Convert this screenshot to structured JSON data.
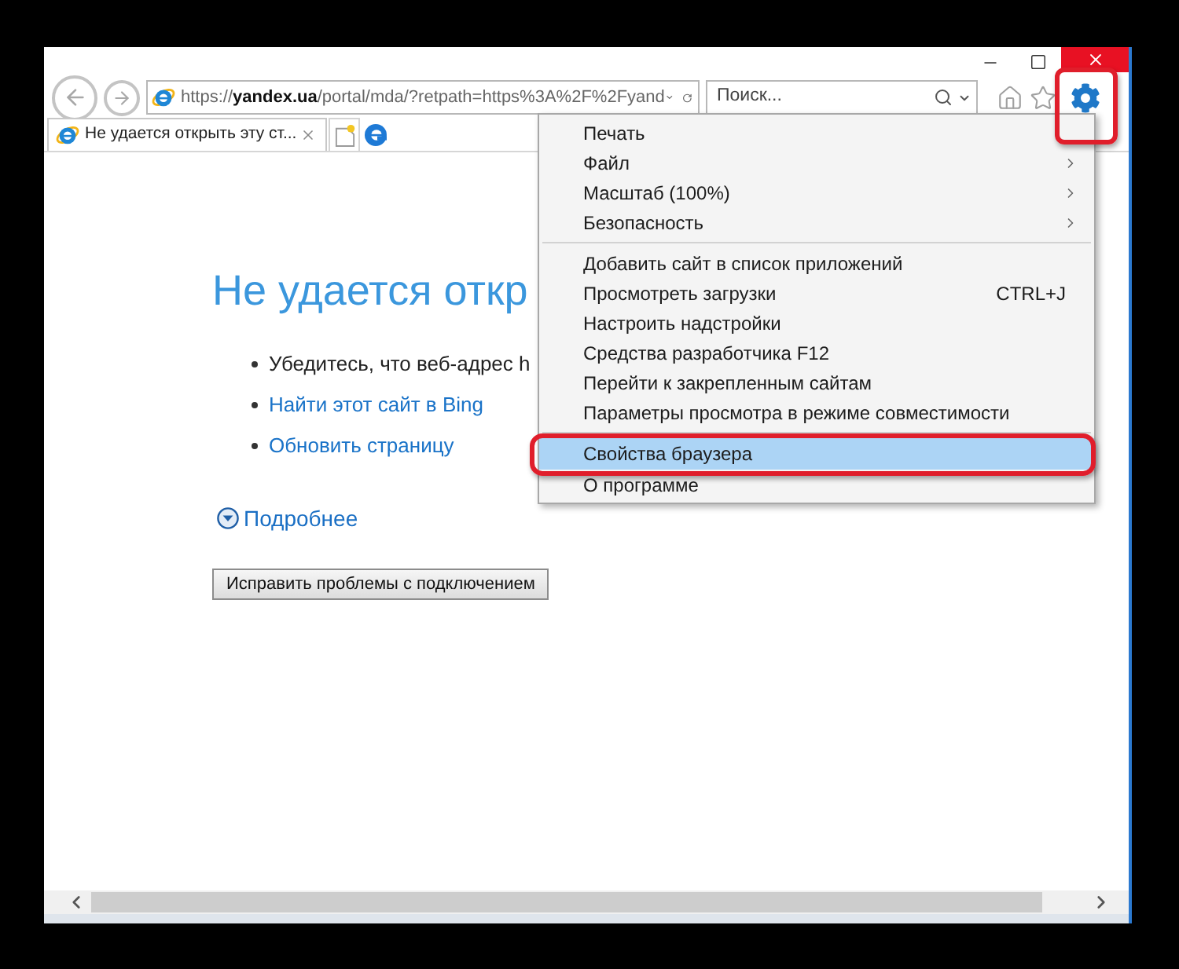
{
  "address_bar": {
    "url": "https://**yandex.ua**/portal/mda/?retpath=https%3A%2F%2Fyand"
  },
  "search": {
    "placeholder": "Поиск..."
  },
  "toolbar": {
    "settings_highlighted": true
  },
  "tabs": [
    {
      "label": "Не удается открыть эту ст...",
      "selected": true
    }
  ],
  "page": {
    "heading": "Не удается откр",
    "bullets": [
      {
        "kind": "text",
        "text": "Убедитесь, что веб-адрес h"
      },
      {
        "kind": "link",
        "text": "Найти этот сайт в Bing"
      },
      {
        "kind": "link",
        "text": "Обновить страницу"
      }
    ],
    "details": {
      "label": "Подробнее",
      "expanded": false
    },
    "fix_button": "Исправить проблемы с подключением"
  },
  "menu": {
    "items": [
      {
        "kind": "item",
        "label": "Печать",
        "submenu": false,
        "selected": false,
        "highlighted": false
      },
      {
        "kind": "item",
        "label": "Файл",
        "submenu": true,
        "selected": false,
        "highlighted": false
      },
      {
        "kind": "item",
        "label": "Масштаб (100%)",
        "submenu": true,
        "selected": false,
        "highlighted": false
      },
      {
        "kind": "item",
        "label": "Безопасность",
        "submenu": true,
        "selected": false,
        "highlighted": false
      },
      {
        "kind": "separator"
      },
      {
        "kind": "item",
        "label": "Добавить сайт в список приложений",
        "submenu": false,
        "selected": false,
        "highlighted": false
      },
      {
        "kind": "item",
        "label": "Просмотреть загрузки",
        "shortcut": "CTRL+J",
        "submenu": false,
        "selected": false,
        "highlighted": false
      },
      {
        "kind": "item",
        "label": "Настроить надстройки",
        "submenu": false,
        "selected": false,
        "highlighted": false
      },
      {
        "kind": "item",
        "label": "Средства разработчика F12",
        "submenu": false,
        "selected": false,
        "highlighted": false
      },
      {
        "kind": "item",
        "label": "Перейти к закрепленным сайтам",
        "submenu": false,
        "selected": false,
        "highlighted": false
      },
      {
        "kind": "item",
        "label": "Параметры просмотра в режиме совместимости",
        "submenu": false,
        "selected": false,
        "highlighted": false
      },
      {
        "kind": "separator"
      },
      {
        "kind": "item",
        "label": "Свойства браузера",
        "submenu": false,
        "selected": true,
        "highlighted": true
      },
      {
        "kind": "item",
        "label": "О программе",
        "submenu": false,
        "selected": false,
        "highlighted": false
      }
    ]
  }
}
